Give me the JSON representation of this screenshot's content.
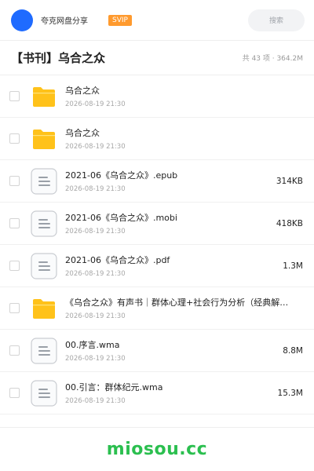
{
  "header": {
    "site_name": "夸克网盘分享",
    "vip_badge": "SVIP",
    "search_label": "搜索"
  },
  "folder": {
    "title": "【书刊】乌合之众",
    "summary": "共 43 项 · 364.2M"
  },
  "files": [
    {
      "name": "乌合之众",
      "date": "2026-08-19 21:30",
      "size": "",
      "type": "folder"
    },
    {
      "name": "乌合之众",
      "date": "2026-08-19 21:30",
      "size": "",
      "type": "folder"
    },
    {
      "name": "2021-06《乌合之众》.epub",
      "date": "2026-08-19 21:30",
      "size": "314KB",
      "type": "document"
    },
    {
      "name": "2021-06《乌合之众》.mobi",
      "date": "2026-08-19 21:30",
      "size": "418KB",
      "type": "document"
    },
    {
      "name": "2021-06《乌合之众》.pdf",
      "date": "2026-08-19 21:30",
      "size": "1.3M",
      "type": "document"
    },
    {
      "name": "《乌合之众》有声书｜群体心理+社会行为分析（经典解…",
      "date": "2026-08-19 21:30",
      "size": "",
      "type": "folder"
    },
    {
      "name": "00.序言.wma",
      "date": "2026-08-19 21:30",
      "size": "8.8M",
      "type": "document"
    },
    {
      "name": "00.引言：群体纪元.wma",
      "date": "2026-08-19 21:30",
      "size": "15.3M",
      "type": "document"
    }
  ],
  "footer": {
    "watermark": "miosou.cc"
  },
  "colors": {
    "avatar": "#1f6bff",
    "badge": "#ff9a2e",
    "folder": "#ffc21a",
    "watermark": "#2bbf4f"
  },
  "icons": {
    "folder": "folder-icon",
    "document": "document-icon"
  }
}
